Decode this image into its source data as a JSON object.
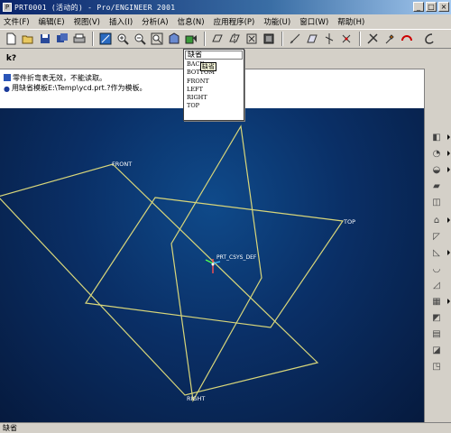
{
  "window": {
    "title": "PRT0001 (活动的) - Pro/ENGINEER 2001",
    "app_icon": "pro-engineer-logo-icon",
    "controls": [
      "minimize-icon",
      "maximize-icon",
      "close-icon"
    ]
  },
  "menu": {
    "items": [
      "文件(F)",
      "编辑(E)",
      "视图(V)",
      "插入(I)",
      "分析(A)",
      "信息(N)",
      "应用程序(P)",
      "功能(U)",
      "窗口(W)",
      "帮助(H)"
    ]
  },
  "toolbar": {
    "icons": [
      "new-file-icon",
      "open-folder-icon",
      "save-icon",
      "save-copy-icon",
      "print-icon",
      "repaint-icon",
      "zoom-in-icon",
      "zoom-out-icon",
      "zoom-fit-icon",
      "orient-icon",
      "saved-views-icon",
      "datum-plane-toggle-icon",
      "datum-axis-toggle-icon",
      "datum-point-toggle-icon",
      "csys-toggle-icon",
      "sketch-icon",
      "datum-plane-tool-icon",
      "datum-axis-tool-icon",
      "datum-point-tool-icon",
      "context-help-icon",
      "tools-icon",
      "spin-center-icon",
      "run-icon"
    ]
  },
  "toolbar2": {
    "context_help_icon": "whats-this-icon"
  },
  "saved_view_menu": {
    "field_value": "缺省",
    "tooltip": "缺省",
    "options": [
      "BACK",
      "BOTTOM",
      "FRONT",
      "LEFT",
      "RIGHT",
      "TOP"
    ]
  },
  "messages": [
    {
      "icon": "info-warning-icon",
      "text": "零件折弯表无效，不能读取。"
    },
    {
      "icon": "bullet-icon",
      "text": "用缺省模板E:\\Temp\\ycd.prt.?作为模板。"
    }
  ],
  "viewport": {
    "plane_labels": {
      "front": "FRONT",
      "top": "TOP",
      "right": "RIGHT"
    },
    "csys_label": "PRT_CSYS_DEF",
    "plane_color": "#d8d67a",
    "background_color": "#0a2f66"
  },
  "right_toolbar": {
    "icons": [
      "extrude-icon",
      "revolve-icon",
      "sweep-icon",
      "blend-icon",
      "hole-icon",
      "shell-icon",
      "rib-icon",
      "draft-icon",
      "round-icon",
      "chamfer-icon",
      "pattern-icon",
      "mirror-icon",
      "copy-icon",
      "merge-icon",
      "trim-icon"
    ]
  },
  "status": {
    "text": "缺省"
  }
}
